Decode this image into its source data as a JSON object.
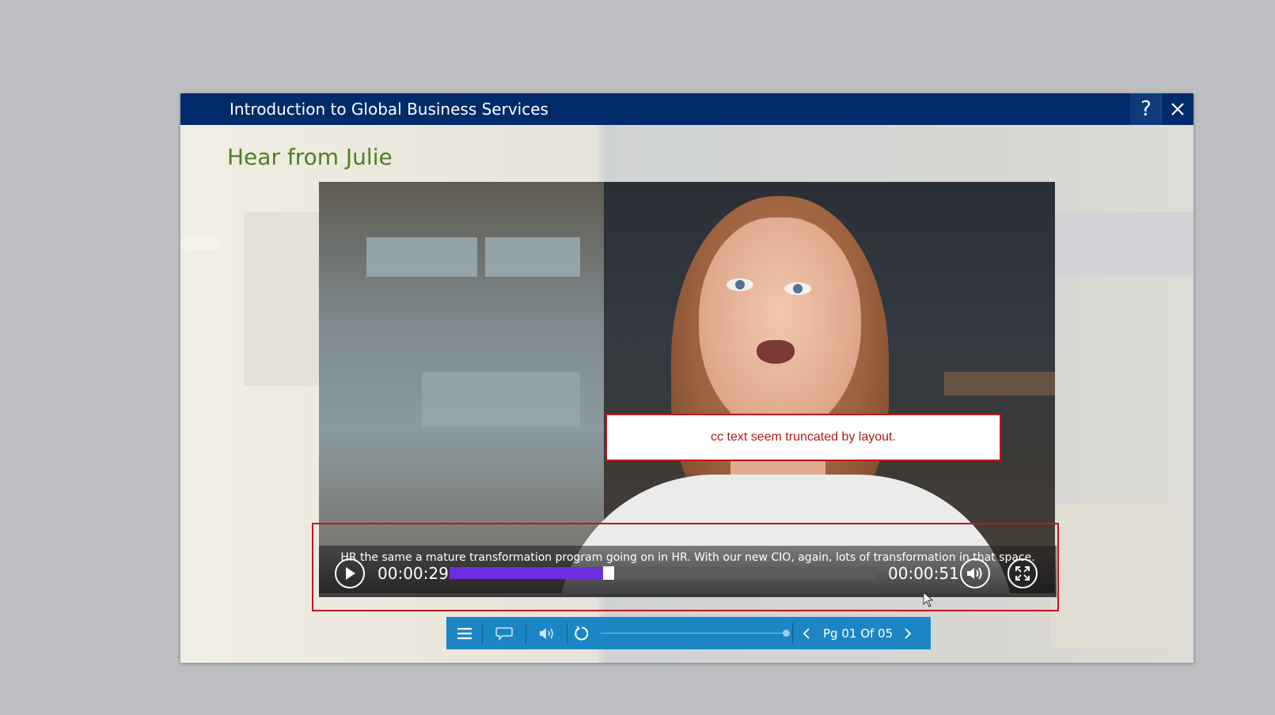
{
  "window": {
    "title": "Introduction to Global Business Services",
    "help_label": "?",
    "titlebar_color": "#002b6b"
  },
  "slide": {
    "heading": "Hear from Julie",
    "heading_color": "#4d7f26"
  },
  "annotation": {
    "note": "cc text seem truncated by layout.",
    "border_color": "#c4161c"
  },
  "video_player": {
    "caption": "HR the same a mature transformation program going on in HR. With our new CIO, again, lots of transformation in that space.",
    "current_time": "00:00:29",
    "total_time": "00:00:51",
    "progress_fraction": 0.373,
    "progress_color": "#6c2ee0",
    "icons": {
      "play": "play-icon",
      "volume": "volume-icon",
      "fullscreen": "fullscreen-icon"
    }
  },
  "course_nav": {
    "page_indicator": "Pg 01 Of 05",
    "bar_color": "#1c86c4",
    "slide_progress_fraction": 1.0,
    "icons": {
      "menu": "menu-icon",
      "transcript": "speech-bubble-icon",
      "audio": "speaker-icon",
      "replay": "replay-icon",
      "prev": "chevron-left-icon",
      "next": "chevron-right-icon"
    }
  }
}
